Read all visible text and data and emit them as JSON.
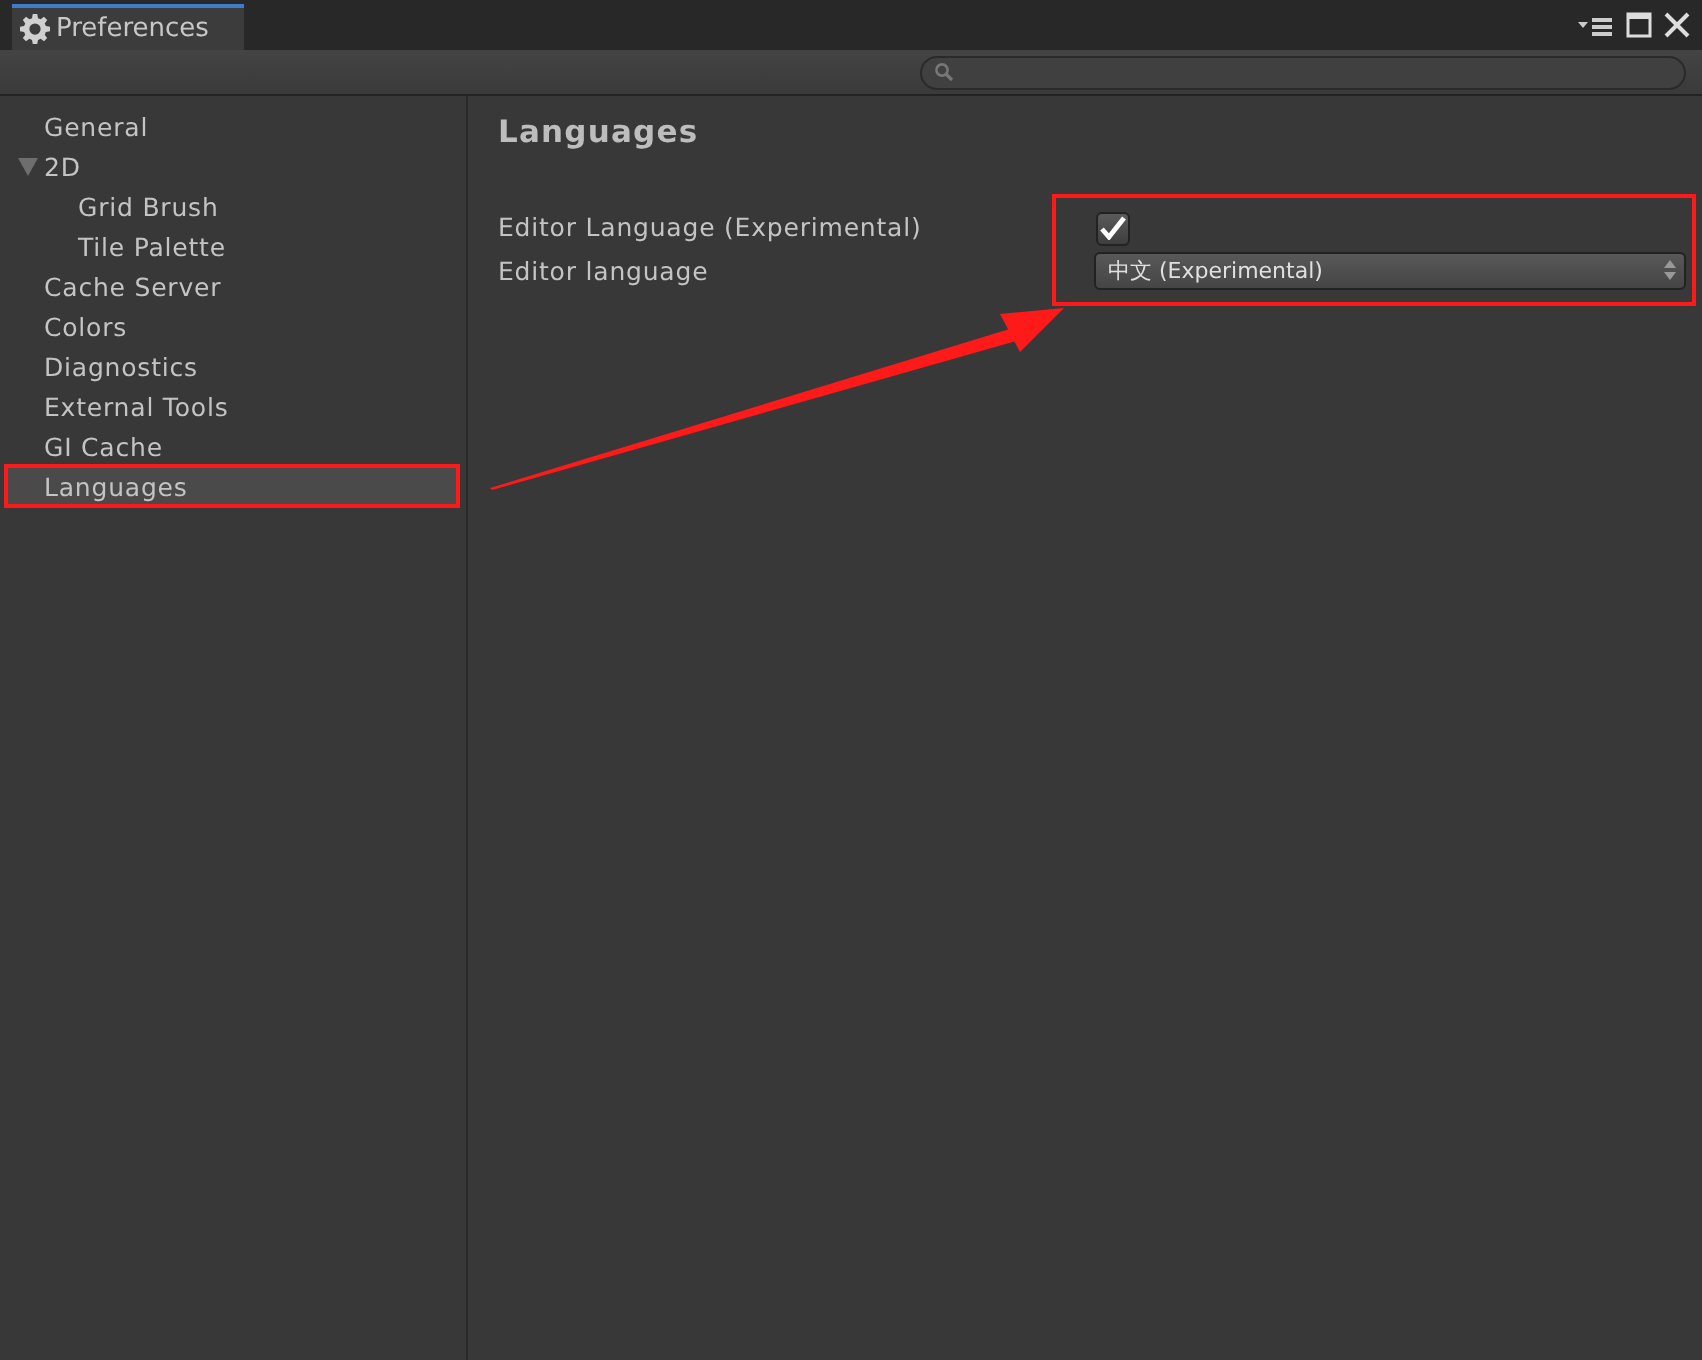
{
  "window": {
    "title": "Preferences"
  },
  "sidebar": {
    "items": [
      {
        "label": "General",
        "selected": false,
        "highlighted": false
      },
      {
        "label": "2D",
        "selected": false,
        "highlighted": false,
        "expanded": true,
        "children": [
          {
            "label": "Grid Brush",
            "selected": false,
            "highlighted": false
          },
          {
            "label": "Tile Palette",
            "selected": false,
            "highlighted": false
          }
        ]
      },
      {
        "label": "Cache Server",
        "selected": false,
        "highlighted": false
      },
      {
        "label": "Colors",
        "selected": false,
        "highlighted": false
      },
      {
        "label": "Diagnostics",
        "selected": false,
        "highlighted": false
      },
      {
        "label": "External Tools",
        "selected": false,
        "highlighted": false
      },
      {
        "label": "GI Cache",
        "selected": false,
        "highlighted": false
      },
      {
        "label": "Languages",
        "selected": true,
        "highlighted": true
      }
    ]
  },
  "content": {
    "title": "Languages",
    "controls_highlighted": true,
    "settings": [
      {
        "kind": "checkbox",
        "label": "Editor Language (Experimental)",
        "checked": true
      },
      {
        "kind": "dropdown",
        "label": "Editor language",
        "value": "中文 (Experimental)"
      }
    ]
  },
  "annotation": {
    "arrow": true
  }
}
